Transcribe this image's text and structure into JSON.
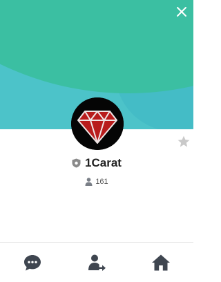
{
  "profile": {
    "name": "1Carat",
    "followers": "161",
    "avatar_icon": "red-diamond-logo"
  },
  "header": {
    "close_icon": "close-icon",
    "cover_colors": [
      "#4cc3c9",
      "#3bbfa2"
    ]
  },
  "favorite": {
    "icon": "star-icon"
  },
  "actions": [
    {
      "name": "chat",
      "icon": "chat-bubble-icon"
    },
    {
      "name": "share-contact",
      "icon": "share-contact-icon"
    },
    {
      "name": "home",
      "icon": "home-icon"
    }
  ],
  "colors": {
    "icon_dark": "#3f4650",
    "badge_gray": "#888888",
    "diamond_red": "#b81c1c"
  }
}
